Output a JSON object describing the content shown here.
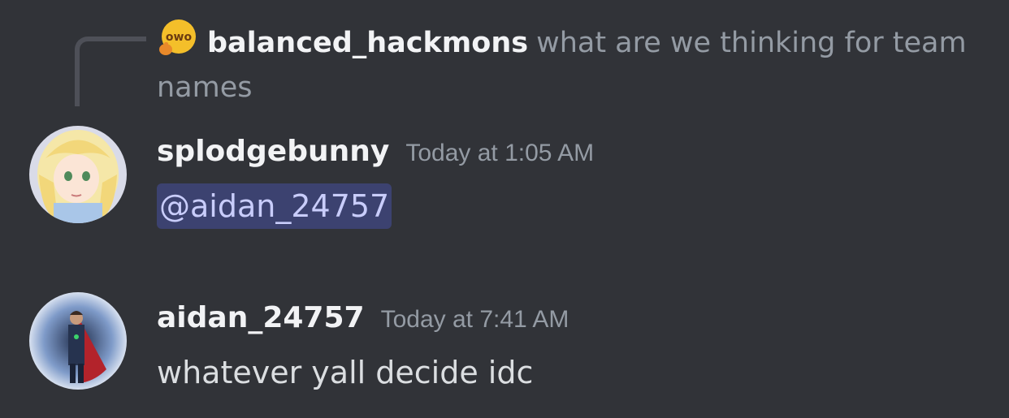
{
  "reply": {
    "avatar_icon": "owo-emoji-avatar",
    "author": "balanced_hackmons",
    "text": "what are we thinking for team names"
  },
  "messages": [
    {
      "username": "splodgebunny",
      "timestamp": "Today at 1:05 AM",
      "avatar_icon": "anime-girl-avatar",
      "mention": "@aidan_24757"
    },
    {
      "username": "aidan_24757",
      "timestamp": "Today at 7:41 AM",
      "avatar_icon": "caped-figure-avatar",
      "text": "whatever yall decide idc"
    }
  ],
  "colors": {
    "background": "#313338",
    "mention_bg": "#3c4270",
    "mention_text": "#c9cdfb",
    "muted": "#949ba4"
  }
}
